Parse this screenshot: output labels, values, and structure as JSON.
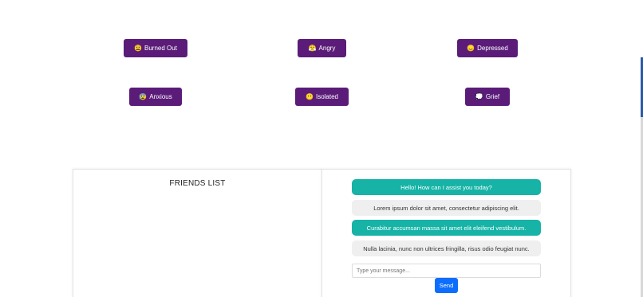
{
  "moods": [
    {
      "id": "burned",
      "icon": "😩",
      "icon_name": "tired-face-icon",
      "label": "Burned Out"
    },
    {
      "id": "angry",
      "icon": "😤",
      "icon_name": "angry-face-icon",
      "label": "Angry"
    },
    {
      "id": "depressed",
      "icon": "😞",
      "icon_name": "sad-face-icon",
      "label": "Depressed"
    },
    {
      "id": "anxious",
      "icon": "😰",
      "icon_name": "anxious-face-icon",
      "label": "Anxious"
    },
    {
      "id": "isolated",
      "icon": "😶",
      "icon_name": "lonely-face-icon",
      "label": "Isolated"
    },
    {
      "id": "grief",
      "icon": "💭",
      "icon_name": "thought-bubble-icon",
      "label": "Grief"
    }
  ],
  "friends": {
    "title": "FRIENDS LIST"
  },
  "chat": {
    "messages": [
      {
        "role": "bot",
        "text": "Hello! How can I assist you today?"
      },
      {
        "role": "user",
        "text": "Lorem ipsum dolor sit amet, consectetur adipiscing elit."
      },
      {
        "role": "bot",
        "text": "Curabitur accumsan massa sit amet elit eleifend vestibulum."
      },
      {
        "role": "user",
        "text": "Nulla lacinia, nunc non ultrices fringilla, risus odio feugiat nunc."
      }
    ],
    "input_value": "",
    "input_placeholder": "Type your message...",
    "send_label": "Send"
  },
  "colors": {
    "mood_button": "#5a1c78",
    "bot_bubble": "#16b3a6",
    "user_bubble": "#efefef",
    "send_button": "#0d6efd"
  }
}
